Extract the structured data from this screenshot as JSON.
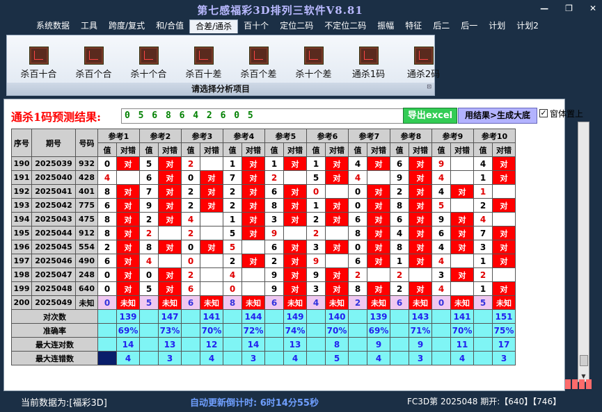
{
  "window": {
    "title": "第七感福彩3D排列三软件V8.81"
  },
  "menu": [
    "系统数据",
    "工具",
    "跨度/复式",
    "和/合值",
    "合差/通杀",
    "百十个",
    "定位二码",
    "不定位二码",
    "振幅",
    "特征",
    "后二",
    "后一",
    "计划",
    "计划2"
  ],
  "menu_active": "合差/通杀",
  "ribbon": {
    "buttons": [
      "杀百十合",
      "杀百个合",
      "杀十个合",
      "杀百十差",
      "杀百个差",
      "杀十个差",
      "通杀1码",
      "通杀2码"
    ],
    "caption": "请选择分析项目"
  },
  "prediction": {
    "label": "通杀1码预测结果:",
    "value": "0 5 6 8 6 4 2 6 0 5",
    "export_label": "导出excel",
    "generate_label": "用结果>生成大底",
    "ontop_label": "窗体置上",
    "ontop_checked": "✓"
  },
  "table": {
    "h_seq": "序号",
    "h_period": "期号",
    "h_number": "号码",
    "refs": [
      "参考1",
      "参考2",
      "参考3",
      "参考4",
      "参考5",
      "参考6",
      "参考7",
      "参考8",
      "参考9",
      "参考10"
    ],
    "sub_val": "值",
    "sub_res": "对错",
    "hit_text": "对",
    "rows": [
      {
        "seq": "190",
        "period": "2025039",
        "num": "932",
        "v": [
          "0",
          "5",
          "2",
          "1",
          "1",
          "1",
          "4",
          "6",
          "9",
          "4"
        ],
        "h": [
          1,
          1,
          0,
          1,
          1,
          1,
          1,
          1,
          0,
          1
        ]
      },
      {
        "seq": "191",
        "period": "2025040",
        "num": "428",
        "v": [
          "4",
          "6",
          "0",
          "7",
          "2",
          "5",
          "4",
          "9",
          "4",
          "1"
        ],
        "h": [
          0,
          1,
          1,
          1,
          0,
          1,
          0,
          1,
          0,
          1
        ]
      },
      {
        "seq": "192",
        "period": "2025041",
        "num": "401",
        "v": [
          "8",
          "7",
          "2",
          "2",
          "6",
          "0",
          "0",
          "2",
          "4",
          "1"
        ],
        "h": [
          1,
          1,
          1,
          1,
          1,
          0,
          1,
          1,
          1,
          0
        ]
      },
      {
        "seq": "193",
        "period": "2025042",
        "num": "775",
        "v": [
          "6",
          "9",
          "2",
          "2",
          "8",
          "1",
          "0",
          "8",
          "5",
          "2"
        ],
        "h": [
          1,
          1,
          1,
          1,
          1,
          1,
          1,
          1,
          0,
          1
        ]
      },
      {
        "seq": "194",
        "period": "2025043",
        "num": "475",
        "v": [
          "8",
          "2",
          "4",
          "1",
          "3",
          "2",
          "6",
          "6",
          "9",
          "4"
        ],
        "h": [
          1,
          1,
          0,
          1,
          1,
          1,
          1,
          1,
          1,
          0
        ]
      },
      {
        "seq": "195",
        "period": "2025044",
        "num": "912",
        "v": [
          "8",
          "2",
          "2",
          "5",
          "9",
          "2",
          "8",
          "4",
          "6",
          "7"
        ],
        "h": [
          1,
          0,
          0,
          1,
          0,
          0,
          1,
          1,
          1,
          1
        ]
      },
      {
        "seq": "196",
        "period": "2025045",
        "num": "554",
        "v": [
          "2",
          "8",
          "0",
          "5",
          "6",
          "3",
          "0",
          "8",
          "4",
          "3"
        ],
        "h": [
          1,
          1,
          1,
          0,
          1,
          1,
          1,
          1,
          1,
          1
        ]
      },
      {
        "seq": "197",
        "period": "2025046",
        "num": "490",
        "v": [
          "6",
          "4",
          "0",
          "2",
          "2",
          "9",
          "6",
          "1",
          "4",
          "1"
        ],
        "h": [
          1,
          0,
          0,
          1,
          1,
          0,
          1,
          1,
          0,
          1
        ]
      },
      {
        "seq": "198",
        "period": "2025047",
        "num": "248",
        "v": [
          "0",
          "0",
          "2",
          "4",
          "9",
          "9",
          "2",
          "2",
          "3",
          "2"
        ],
        "h": [
          1,
          1,
          0,
          0,
          1,
          1,
          0,
          0,
          1,
          0
        ]
      },
      {
        "seq": "199",
        "period": "2025048",
        "num": "640",
        "v": [
          "0",
          "5",
          "6",
          "0",
          "9",
          "3",
          "8",
          "2",
          "4",
          "1"
        ],
        "h": [
          1,
          1,
          0,
          0,
          1,
          1,
          1,
          1,
          0,
          1
        ]
      }
    ],
    "pred_row": {
      "seq": "200",
      "period": "2025049",
      "num": "未知",
      "v": [
        "0",
        "5",
        "6",
        "8",
        "6",
        "4",
        "2",
        "6",
        "0",
        "5"
      ],
      "res": "未知"
    },
    "stats": [
      {
        "label": "对次数",
        "values": [
          "139",
          "147",
          "141",
          "144",
          "149",
          "140",
          "139",
          "143",
          "141",
          "151"
        ]
      },
      {
        "label": "准确率",
        "values": [
          "69%",
          "73%",
          "70%",
          "72%",
          "74%",
          "70%",
          "69%",
          "71%",
          "70%",
          "75%"
        ]
      },
      {
        "label": "最大连对数",
        "values": [
          "14",
          "13",
          "12",
          "14",
          "13",
          "8",
          "9",
          "9",
          "11",
          "17"
        ]
      },
      {
        "label": "最大连错数",
        "values": [
          "4",
          "3",
          "4",
          "3",
          "4",
          "5",
          "4",
          "3",
          "4",
          "3"
        ]
      }
    ]
  },
  "status": {
    "data_label": "当前数据为:[福彩3D]",
    "countdown": "自动更新倒计时: 6时14分55秒",
    "period_info": "FC3D第 2025048 期开:【640】【746】"
  },
  "colors": {
    "hit": "#ff0000",
    "stat_bg": "#7ff5f5",
    "pred_bg": "#f0c8f0",
    "bg": "#1b2f45",
    "export": "#33cc55",
    "generate": "#b3b3ff"
  }
}
